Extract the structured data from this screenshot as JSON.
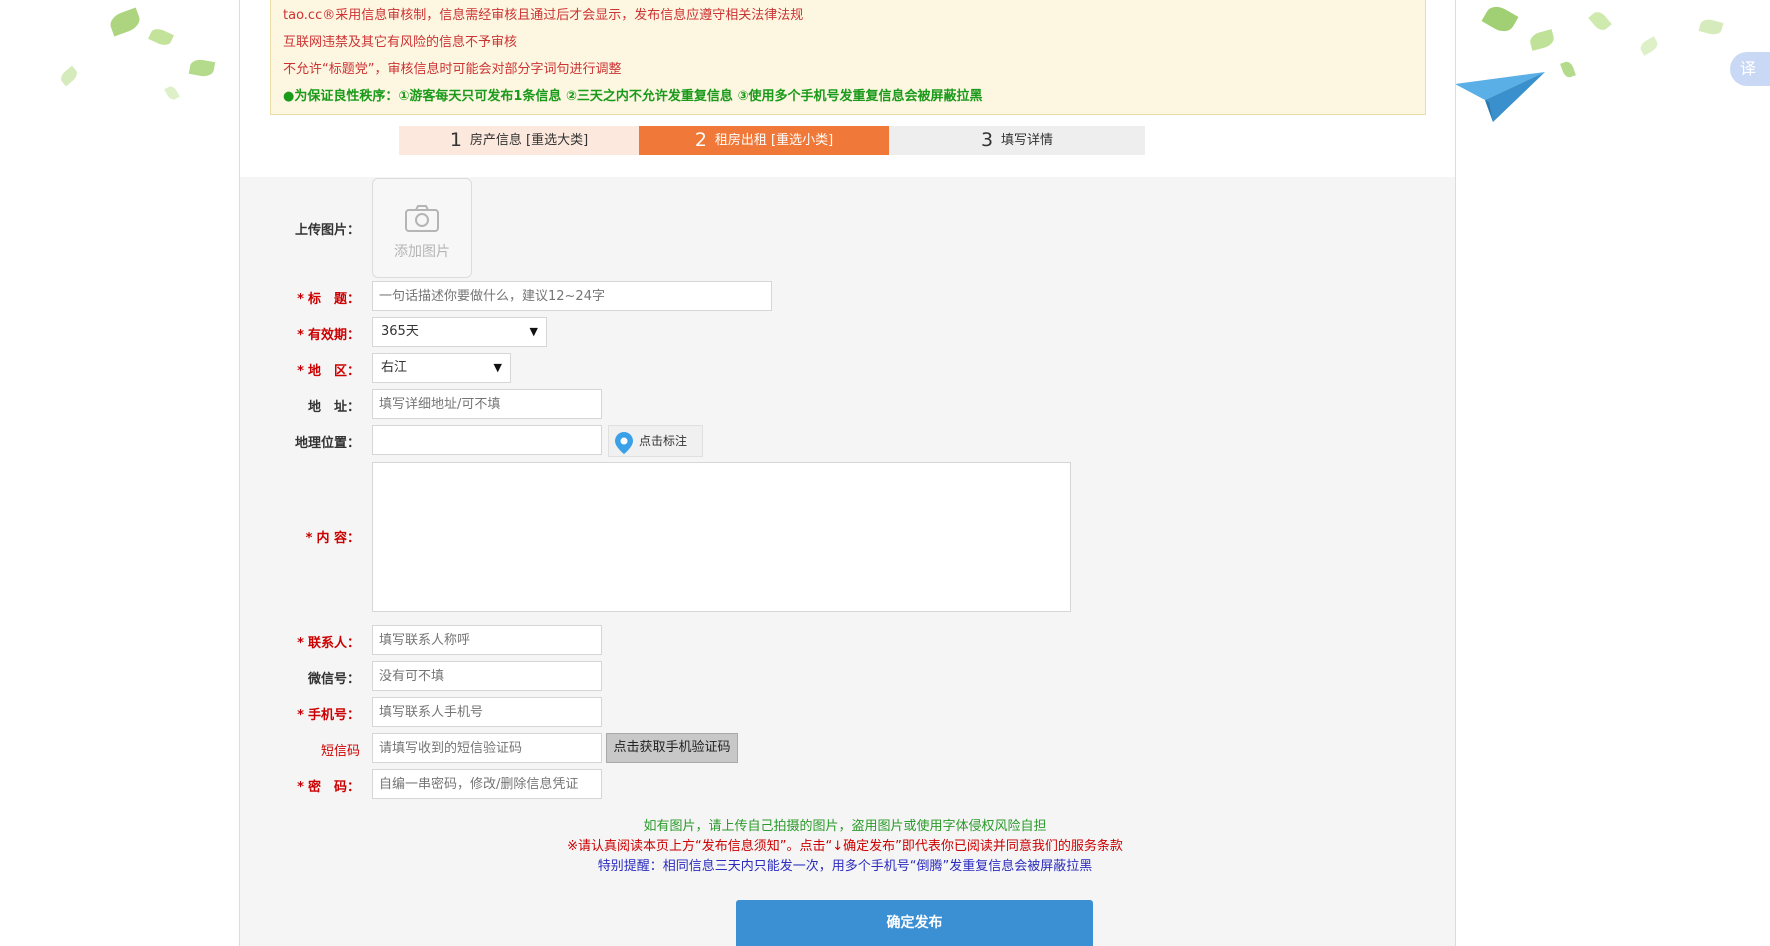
{
  "notice": {
    "line1": "tao.cc®采用信息审核制，信息需经审核且通过后才会显示，发布信息应遵守相关法律法规",
    "line2": "互联网违禁及其它有风险的信息不予审核",
    "line3": "不允许“标题党”，审核信息时可能会对部分字词句进行调整",
    "line4": "●为保证良性秩序：①游客每天只可发布1条信息 ②三天之内不允许发重复信息 ③使用多个手机号发重复信息会被屏蔽拉黑"
  },
  "steps": [
    {
      "num": "1",
      "label": "房产信息 [重选大类]"
    },
    {
      "num": "2",
      "label": "租房出租 [重选小类]"
    },
    {
      "num": "3",
      "label": "填写详情"
    }
  ],
  "form": {
    "upload_label": "上传图片：",
    "upload_text": "添加图片",
    "required_mark": "*",
    "title_label": "标　题：",
    "title_placeholder": "一句话描述你要做什么，建议12~24字",
    "validity_label": "有效期：",
    "validity_value": "365天",
    "region_label": "地　区：",
    "region_value": "右江",
    "address_label": "地　址：",
    "address_placeholder": "填写详细地址/可不填",
    "geo_label": "地理位置：",
    "geo_button": "点击标注",
    "content_label": "内 容：",
    "contact_label": "联系人：",
    "contact_placeholder": "填写联系人称呼",
    "wechat_label": "微信号：",
    "wechat_placeholder": "没有可不填",
    "phone_label": "手机号：",
    "phone_placeholder": "填写联系人手机号",
    "sms_label": "短信码",
    "sms_placeholder": "请填写收到的短信验证码",
    "sms_button": "点击获取手机验证码",
    "password_label": "密　码：",
    "password_placeholder": "自编一串密码，修改/删除信息凭证"
  },
  "notes": {
    "n1": "如有图片，请上传自己拍摄的图片，盗用图片或使用字体侵权风险自担",
    "n2": "※请认真阅读本页上方“发布信息须知”。点击“↓确定发布”即代表你已阅读并同意我们的服务条款",
    "n3": "特别提醒：相同信息三天内只能发一次，用多个手机号“倒腾”发重复信息会被屏蔽拉黑"
  },
  "submit_label": "确定发布",
  "translate_label": "译",
  "colors": {
    "accent": "#f07838",
    "submit": "#3b8fd3",
    "required": "#cc0000",
    "notice_bg": "#fdf6e0"
  }
}
